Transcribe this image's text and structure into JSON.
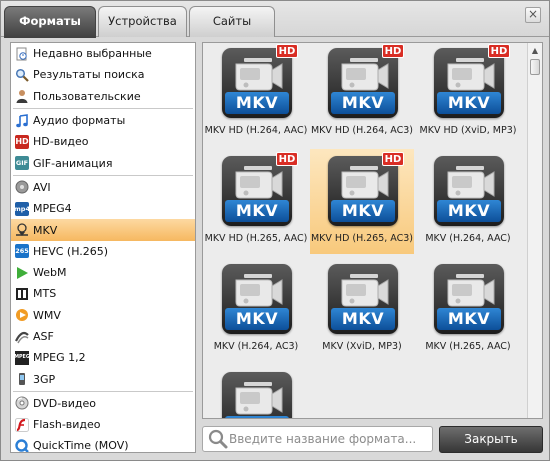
{
  "tabs": [
    {
      "label": "Форматы",
      "active": true
    },
    {
      "label": "Устройства",
      "active": false
    },
    {
      "label": "Сайты",
      "active": false
    }
  ],
  "close_glyph": "×",
  "sidebar": {
    "groups": [
      [
        {
          "label": "Недавно выбранные",
          "icon": "recent-icon"
        },
        {
          "label": "Результаты поиска",
          "icon": "search-results-icon"
        },
        {
          "label": "Пользовательские",
          "icon": "user-icon"
        }
      ],
      [
        {
          "label": "Аудио форматы",
          "icon": "music-note-icon"
        },
        {
          "label": "HD-видео",
          "icon": "hd-icon"
        },
        {
          "label": "GIF-анимация",
          "icon": "gif-icon"
        }
      ],
      [
        {
          "label": "AVI",
          "icon": "avi-icon"
        },
        {
          "label": "MPEG4",
          "icon": "mp4-icon"
        },
        {
          "label": "MKV",
          "icon": "mkv-icon",
          "selected": true
        },
        {
          "label": "HEVC (H.265)",
          "icon": "hevc-icon"
        },
        {
          "label": "WebM",
          "icon": "webm-icon"
        },
        {
          "label": "MTS",
          "icon": "mts-icon"
        },
        {
          "label": "WMV",
          "icon": "wmv-icon"
        },
        {
          "label": "ASF",
          "icon": "asf-icon"
        },
        {
          "label": "MPEG 1,2",
          "icon": "mpeg-icon"
        },
        {
          "label": "3GP",
          "icon": "phone-icon"
        }
      ],
      [
        {
          "label": "DVD-видео",
          "icon": "dvd-icon"
        },
        {
          "label": "Flash-видео",
          "icon": "flash-icon"
        },
        {
          "label": "QuickTime (MOV)",
          "icon": "quicktime-icon"
        }
      ]
    ]
  },
  "icon_text": {
    "hd": "HD",
    "gif": "GIF",
    "mp4": "mp4",
    "hevc": "265",
    "mpeg": "MPEG",
    "badge": "HD",
    "band": "MKV"
  },
  "formats": [
    {
      "label": "MKV HD (H.264, AAC)",
      "hd": true
    },
    {
      "label": "MKV HD (H.264, AC3)",
      "hd": true
    },
    {
      "label": "MKV HD (XviD, MP3)",
      "hd": true
    },
    {
      "label": "MKV HD (H.265, AAC)",
      "hd": true
    },
    {
      "label": "MKV HD (H.265, AC3)",
      "hd": true,
      "selected": true
    },
    {
      "label": "MKV (H.264, AAC)",
      "hd": false
    },
    {
      "label": "MKV (H.264, AC3)",
      "hd": false
    },
    {
      "label": "MKV (XviD, MP3)",
      "hd": false
    },
    {
      "label": "MKV (H.265, AAC)",
      "hd": false
    },
    {
      "label": "",
      "hd": false
    }
  ],
  "search": {
    "placeholder": "Введите название формата..."
  },
  "close_button": "Закрыть",
  "colors": {
    "selected_orange": "#f6b860",
    "band_blue": "#1565b5",
    "hd_red": "#d92d24"
  }
}
